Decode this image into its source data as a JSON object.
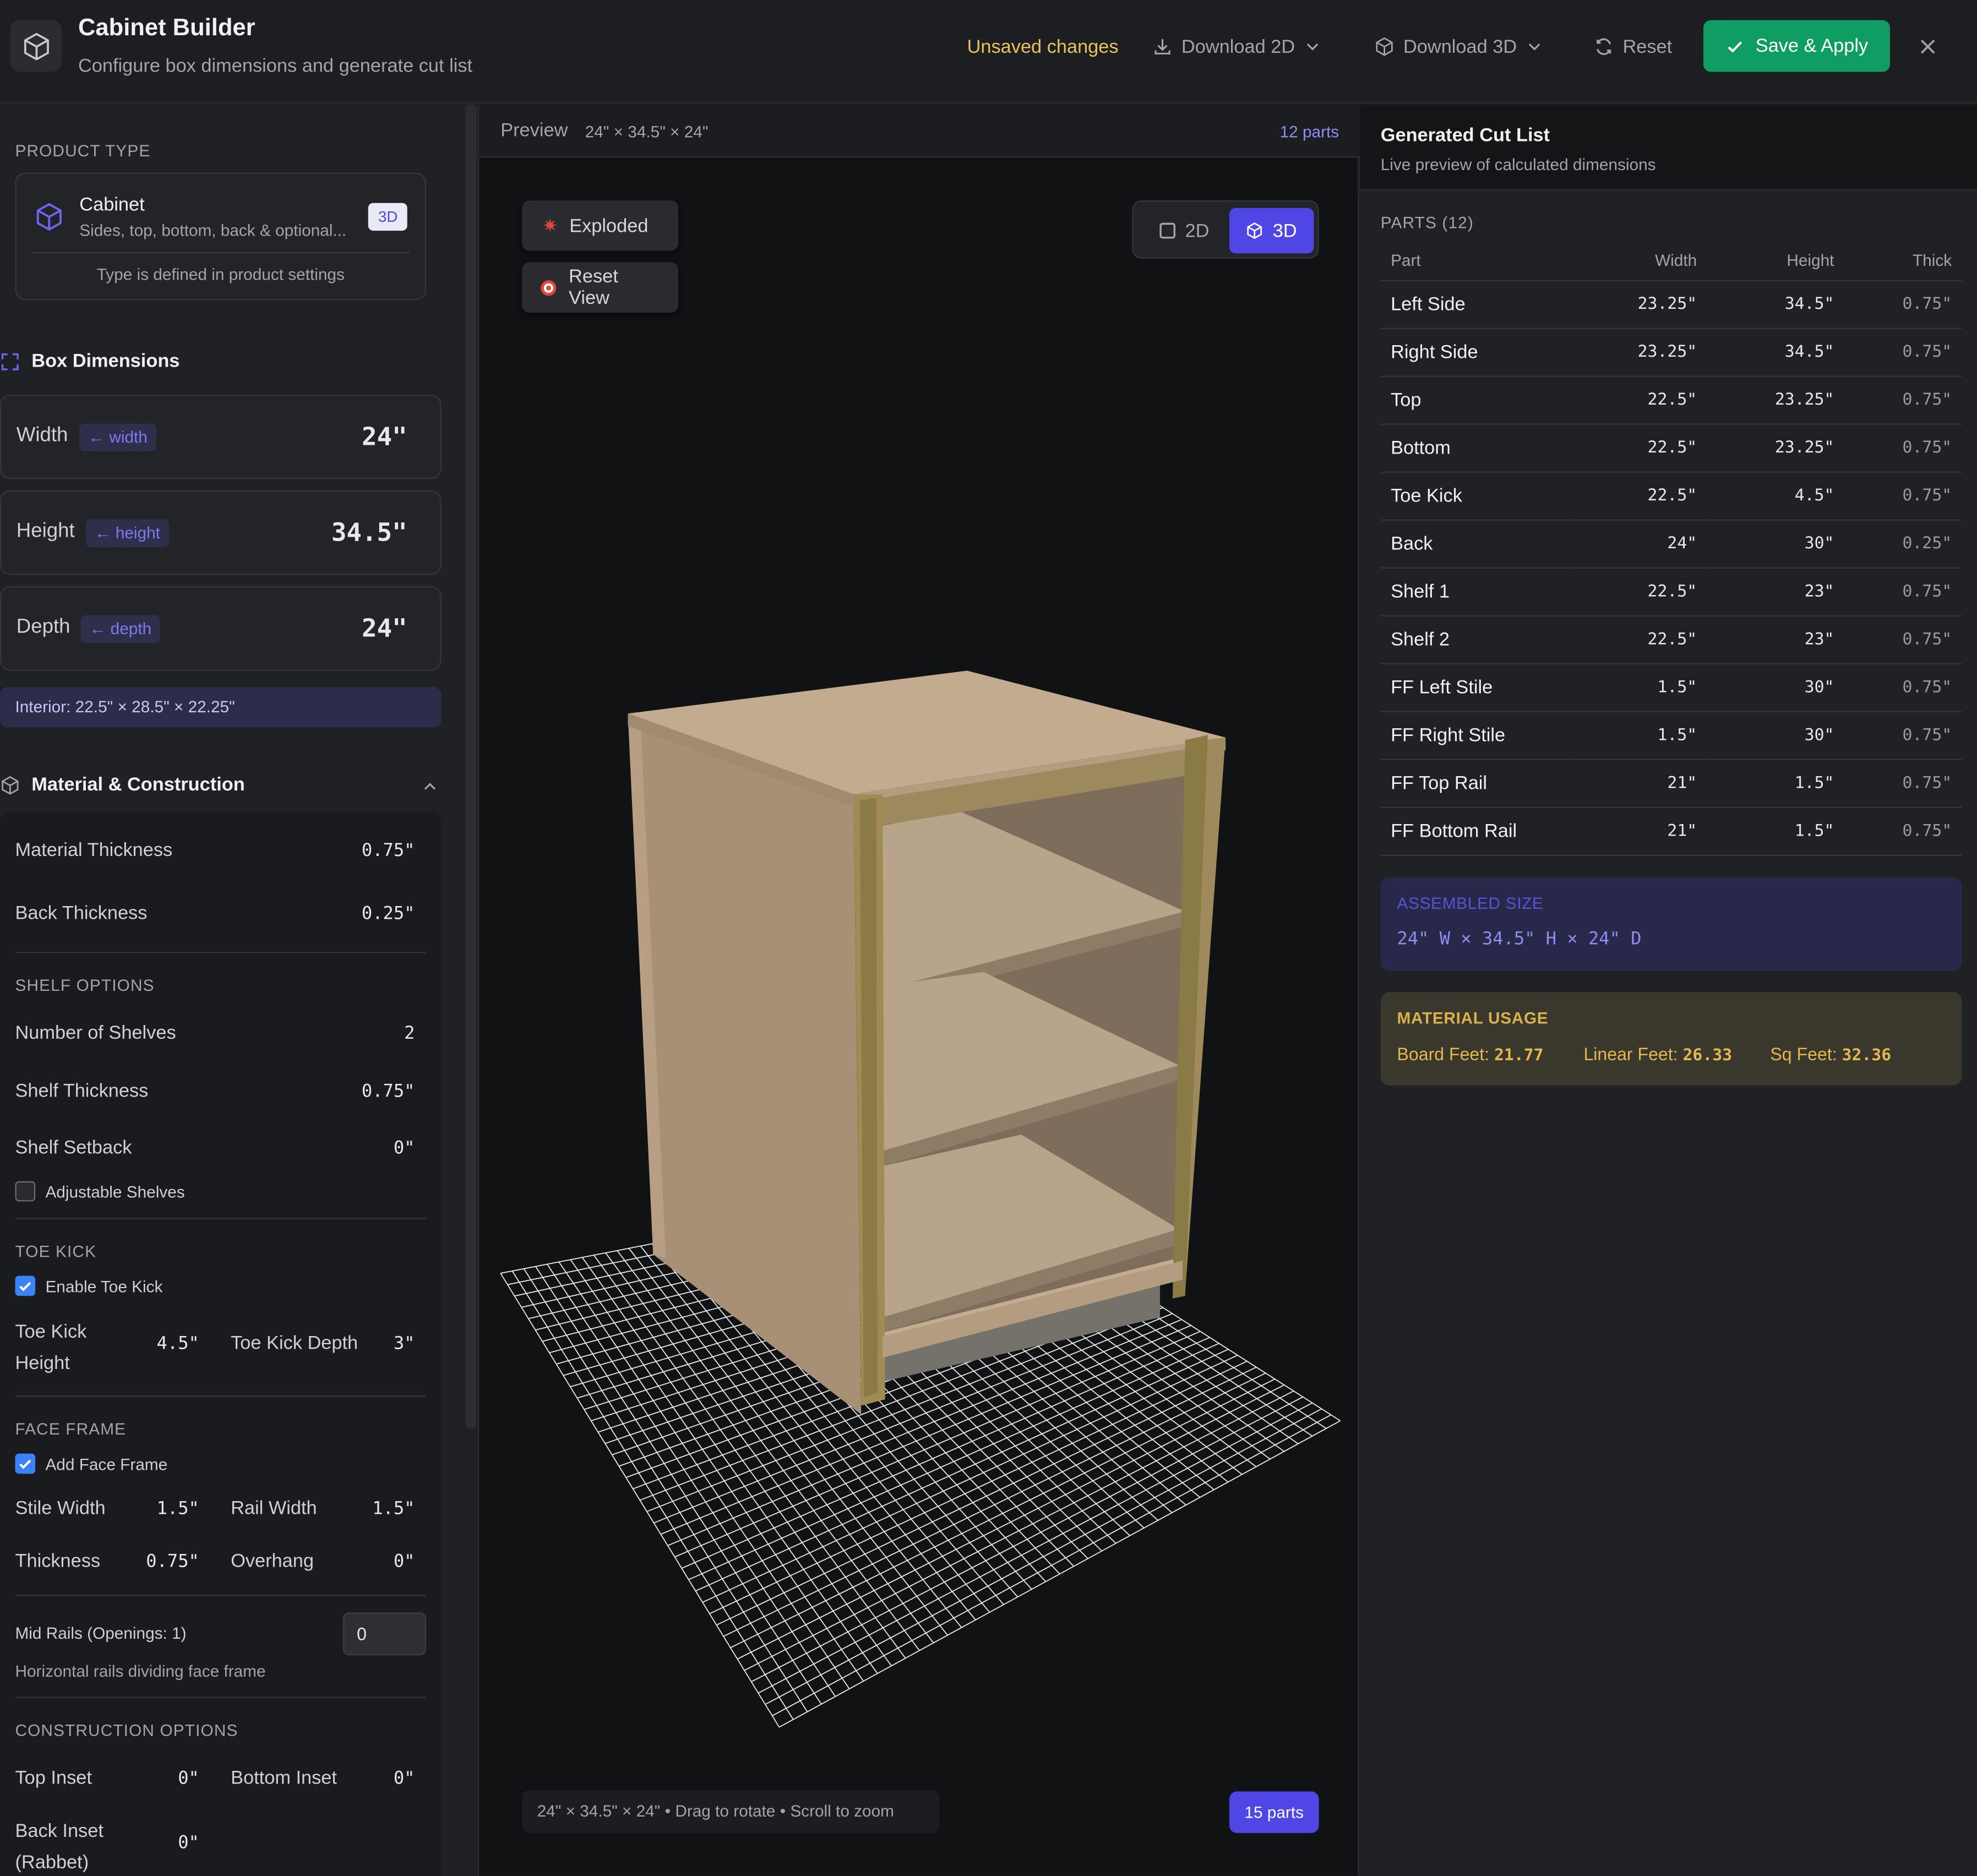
{
  "header": {
    "title": "Cabinet Builder",
    "subtitle": "Configure box dimensions and generate cut list",
    "unsaved": "Unsaved changes",
    "download_2d": "Download 2D",
    "download_3d": "Download 3D",
    "reset": "Reset",
    "save_apply": "Save & Apply"
  },
  "left": {
    "product_type_label": "PRODUCT TYPE",
    "product_name": "Cabinet",
    "product_desc": "Sides, top, bottom, back & optional...",
    "product_badge": "3D",
    "product_note": "Type is defined in product settings",
    "box_dimensions": "Box Dimensions",
    "dims": [
      {
        "label": "Width",
        "tag": "← width",
        "value": "24\""
      },
      {
        "label": "Height",
        "tag": "← height",
        "value": "34.5\""
      },
      {
        "label": "Depth",
        "tag": "← depth",
        "value": "24\""
      }
    ],
    "interior": "Interior: 22.5\" × 28.5\" × 22.25\"",
    "material_construction": "Material & Construction",
    "material_thickness_label": "Material Thickness",
    "material_thickness": "0.75\"",
    "back_thickness_label": "Back Thickness",
    "back_thickness": "0.25\"",
    "shelf_options": "SHELF OPTIONS",
    "num_shelves_label": "Number of Shelves",
    "num_shelves": "2",
    "shelf_thickness_label": "Shelf Thickness",
    "shelf_thickness": "0.75\"",
    "shelf_setback_label": "Shelf Setback",
    "shelf_setback": "0\"",
    "adjustable_shelves": "Adjustable Shelves",
    "toe_kick": "TOE KICK",
    "enable_toe_kick": "Enable Toe Kick",
    "toe_kick_height_label": "Toe Kick Height",
    "toe_kick_height": "4.5\"",
    "toe_kick_depth_label": "Toe Kick Depth",
    "toe_kick_depth": "3\"",
    "face_frame": "FACE FRAME",
    "add_face_frame": "Add Face Frame",
    "stile_width_label": "Stile Width",
    "stile_width": "1.5\"",
    "rail_width_label": "Rail Width",
    "rail_width": "1.5\"",
    "thickness_label": "Thickness",
    "thickness": "0.75\"",
    "overhang_label": "Overhang",
    "overhang": "0\"",
    "mid_rails_label": "Mid Rails (Openings: 1)",
    "mid_rails_value": "0",
    "mid_rails_help": "Horizontal rails dividing face frame",
    "construction_options": "CONSTRUCTION OPTIONS",
    "top_inset_label": "Top Inset",
    "top_inset": "0\"",
    "bottom_inset_label": "Bottom Inset",
    "bottom_inset": "0\"",
    "back_inset_label": "Back Inset (Rabbet)",
    "back_inset": "0\""
  },
  "center": {
    "preview_label": "Preview",
    "preview_dims": "24\" × 34.5\" × 24\"",
    "preview_parts": "12 parts",
    "exploded": "Exploded",
    "reset_view": "Reset View",
    "view_2d": "2D",
    "view_3d": "3D",
    "hint": "24\" × 34.5\" × 24\"  •  Drag to rotate • Scroll to zoom",
    "parts_badge": "15 parts"
  },
  "right": {
    "title": "Generated Cut List",
    "subtitle": "Live preview of calculated dimensions",
    "parts_label": "PARTS (12)",
    "columns": [
      "Part",
      "Width",
      "Height",
      "Thick"
    ],
    "rows": [
      [
        "Left Side",
        "23.25\"",
        "34.5\"",
        "0.75\""
      ],
      [
        "Right Side",
        "23.25\"",
        "34.5\"",
        "0.75\""
      ],
      [
        "Top",
        "22.5\"",
        "23.25\"",
        "0.75\""
      ],
      [
        "Bottom",
        "22.5\"",
        "23.25\"",
        "0.75\""
      ],
      [
        "Toe Kick",
        "22.5\"",
        "4.5\"",
        "0.75\""
      ],
      [
        "Back",
        "24\"",
        "30\"",
        "0.25\""
      ],
      [
        "Shelf 1",
        "22.5\"",
        "23\"",
        "0.75\""
      ],
      [
        "Shelf 2",
        "22.5\"",
        "23\"",
        "0.75\""
      ],
      [
        "FF Left Stile",
        "1.5\"",
        "30\"",
        "0.75\""
      ],
      [
        "FF Right Stile",
        "1.5\"",
        "30\"",
        "0.75\""
      ],
      [
        "FF Top Rail",
        "21\"",
        "1.5\"",
        "0.75\""
      ],
      [
        "FF Bottom Rail",
        "21\"",
        "1.5\"",
        "0.75\""
      ]
    ],
    "assembled_label": "ASSEMBLED SIZE",
    "assembled_value": "24\" W × 34.5\" H × 24\" D",
    "usage_label": "MATERIAL USAGE",
    "board_feet_label": "Board Feet:",
    "board_feet": "21.77",
    "linear_feet_label": "Linear Feet:",
    "linear_feet": "26.33",
    "sq_feet_label": "Sq Feet:",
    "sq_feet": "32.36"
  },
  "colors": {
    "accent": "#4f46e5",
    "save": "#0f9d63",
    "unsaved": "#e6c35c",
    "wood": "#a89378",
    "face_frame": "#8a7a45"
  }
}
